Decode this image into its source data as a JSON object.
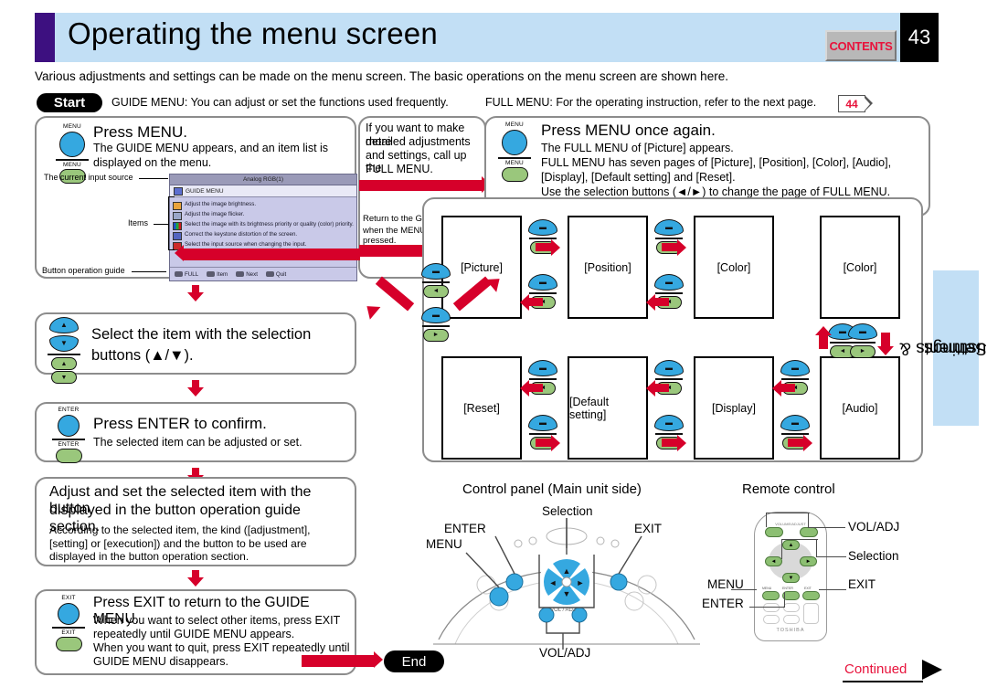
{
  "header": {
    "title": "Operating the menu screen",
    "contents_label": "CONTENTS",
    "page_number": "43"
  },
  "intro": {
    "lede": "Various adjustments and settings can be made on the menu screen. The basic operations on the menu screen are shown here.",
    "start_badge": "Start",
    "start_text": "GUIDE MENU: You can adjust or set the functions used frequently.",
    "full_text": "FULL MENU: For the operating instruction, refer to the next page.",
    "page_ref": "44"
  },
  "steps": [
    {
      "button": "MENU",
      "heading": "Press MENU.",
      "sub": "The GUIDE MENU appears, and an item list is displayed on the menu."
    },
    {
      "heading": "Select the item with the selection",
      "heading2": "buttons (▲/▼)."
    },
    {
      "button": "ENTER",
      "heading": "Press ENTER to confirm.",
      "sub": "The selected item can be adjusted or set."
    },
    {
      "heading": "Adjust and set the selected item with the button",
      "heading2": "displayed in the button operation guide section.",
      "sub": "According to the selected item, the kind ([adjustment], [setting] or [execution]) and the button to be used are displayed in the button operation section."
    },
    {
      "button": "EXIT",
      "heading": "Press EXIT to return to the GUIDE MENU.",
      "sub1": "When you want to select other items, press EXIT",
      "sub2": "repeatedly until GUIDE MENU appears.",
      "sub3": "When you want to quit, press EXIT repeatedly until",
      "sub4": "GUIDE MENU disappears."
    }
  ],
  "osd": {
    "title": "Analog RGB(1)",
    "menu_label": "GUIDE MENU",
    "items": [
      "Adjust the image brightness.",
      "Adjust the image flicker.",
      "Select the image with its brightness priority or quality (color) priority.",
      "Correct the keystone distortion of the screen.",
      "Select the input source when changing the input."
    ],
    "footer": [
      "FULL",
      "Item",
      "Next",
      "Quit"
    ],
    "callout_source": "The current input source",
    "callout_items": "Items",
    "callout_guide": "Button operation guide"
  },
  "midnote": {
    "line1": "If you want to make more",
    "line2": "detailed adjustments",
    "line3": "and settings, call up the",
    "line4": "FULL MENU.",
    "return1": "Return to the GUIDE MENU",
    "return2": "when the MENU button is pressed."
  },
  "fullmenu": {
    "button": "MENU",
    "heading": "Press MENU once again.",
    "sub1": "The FULL MENU of [Picture] appears.",
    "sub2": "FULL MENU has seven pages of [Picture], [Position], [Color], [Audio],",
    "sub3": "[Display], [Default setting] and [Reset].",
    "sub4": "Use the selection buttons (◄/►) to change the page of FULL MENU.",
    "pages": [
      "[Picture]",
      "[Position]",
      "[Color]",
      "[Audio]",
      "[Display]",
      "[Default setting]",
      "[Reset]"
    ]
  },
  "sidetab": {
    "line1": "Adjustments &",
    "line2": "Settings"
  },
  "controlpanel": {
    "title": "Control panel (Main unit side)",
    "labels": {
      "selection": "Selection",
      "enter": "ENTER",
      "menu": "MENU",
      "exit": "EXIT",
      "voladj": "VOL/ADJ"
    }
  },
  "remote": {
    "title": "Remote control",
    "brand": "TOSHIBA",
    "labels": {
      "voladj": "VOL/ADJ",
      "selection": "Selection",
      "menu": "MENU",
      "enter": "ENTER",
      "exit": "EXIT"
    }
  },
  "footer": {
    "end_badge": "End",
    "continued": "Continued"
  }
}
